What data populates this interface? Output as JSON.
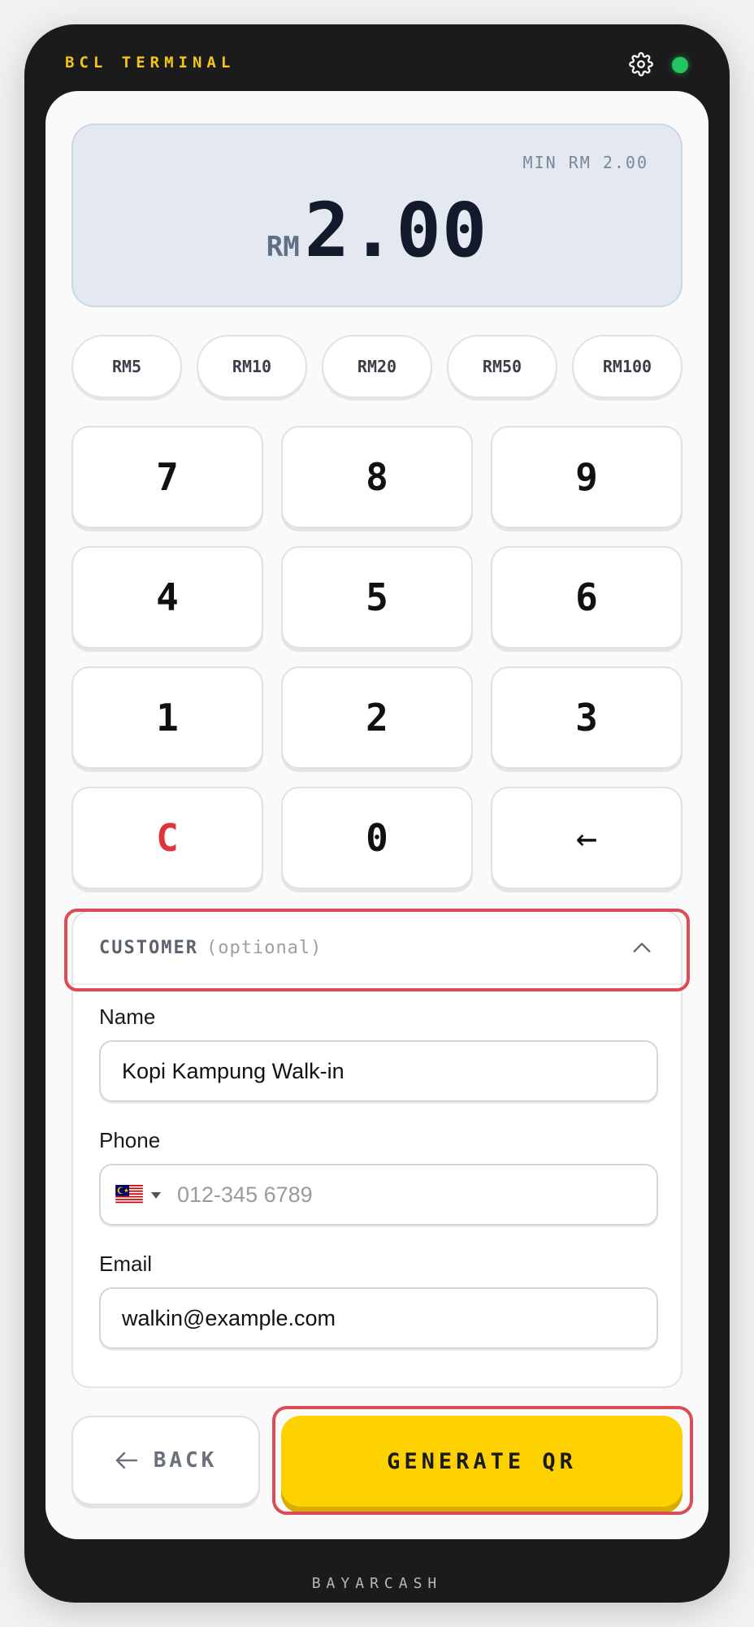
{
  "header": {
    "brand": "BCL TERMINAL",
    "settings_icon": "gear-icon",
    "status_indicator_color": "#22c55e"
  },
  "display": {
    "min_label": "MIN RM 2.00",
    "currency": "RM",
    "amount": "2.00"
  },
  "quick_amounts": [
    {
      "label": "RM5"
    },
    {
      "label": "RM10"
    },
    {
      "label": "RM20"
    },
    {
      "label": "RM50"
    },
    {
      "label": "RM100"
    }
  ],
  "keypad": {
    "k7": "7",
    "k8": "8",
    "k9": "9",
    "k4": "4",
    "k5": "5",
    "k6": "6",
    "k1": "1",
    "k2": "2",
    "k3": "3",
    "clear": "C",
    "k0": "0",
    "backspace": "←"
  },
  "customer": {
    "title": "CUSTOMER",
    "optional": "(optional)",
    "expanded": true,
    "name": {
      "label": "Name",
      "value": "Kopi Kampung Walk-in"
    },
    "phone": {
      "label": "Phone",
      "value": "",
      "placeholder": "012-345 6789",
      "country": "MY"
    },
    "email": {
      "label": "Email",
      "value": "walkin@example.com"
    }
  },
  "actions": {
    "back_label": "BACK",
    "generate_label": "GENERATE QR"
  },
  "footer": {
    "brand": "BAYARCASH"
  },
  "colors": {
    "accent": "#fdd200",
    "brand_text": "#f4c518",
    "clear_key": "#e2333a",
    "highlight": "#dc4c55"
  }
}
